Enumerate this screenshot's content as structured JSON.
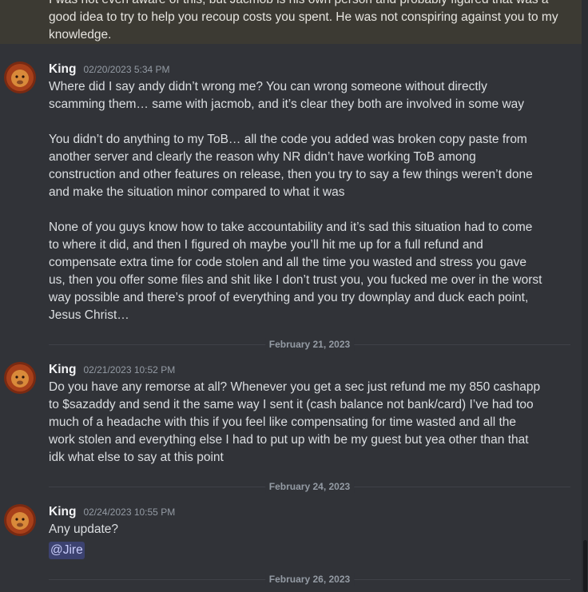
{
  "top_message": {
    "text": "I was not even aware of this, but Jacmob is his own person and probably figured that was a good idea to try to help you recoup costs you spent. He was not conspiring against you to my knowledge."
  },
  "messages": [
    {
      "username": "King",
      "timestamp": "02/20/2023 5:34 PM",
      "paragraphs": [
        "Where did I say andy didn’t wrong me? You can wrong someone without directly scamming them… same with jacmob, and it’s clear they both are involved in some way",
        "You didn’t do anything to my ToB… all the code you added was broken copy paste from another server and clearly the reason why NR didn’t have working ToB among construction and other features on release, then you try to say a few things weren’t done and make the situation minor compared to what it was",
        "None of you guys know how to take accountability and it’s sad this situation had to come to where it did, and then I figured oh maybe you’ll hit me up for a full refund and compensate extra time for code stolen and all the time you wasted and stress you gave us, then you offer some files and shit like I don’t trust you, you fucked me over in the worst way possible and there’s proof of everything and you try downplay and duck each point, Jesus Christ…"
      ]
    },
    {
      "username": "King",
      "timestamp": "02/21/2023 10:52 PM",
      "paragraphs": [
        "Do you have any remorse at all? Whenever you get a sec just refund me my 850 cashapp to $sazaddy and send it the same way I sent it (cash balance not bank/card) I’ve had too much of a headache with this if you feel like compensating for time wasted and all the work stolen and everything else I had to put up with be my guest but yea other than that idk what else to say at this point"
      ]
    },
    {
      "username": "King",
      "timestamp": "02/24/2023 10:55 PM",
      "paragraphs": [
        "Any update?"
      ],
      "mention": "@Jire"
    }
  ],
  "dividers": [
    "February 21, 2023",
    "February 24, 2023",
    "February 26, 2023"
  ]
}
